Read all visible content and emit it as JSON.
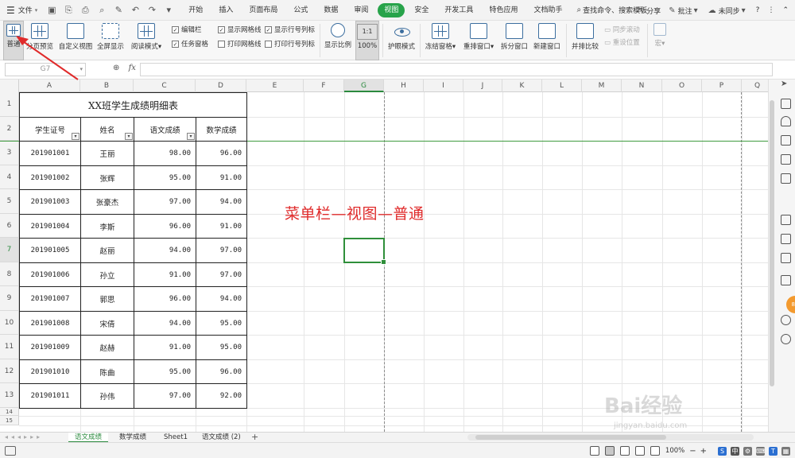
{
  "menubar": {
    "file_label": "文件",
    "tabs": [
      "开始",
      "插入",
      "页面布局",
      "公式",
      "数据",
      "审阅",
      "视图",
      "安全",
      "开发工具",
      "特色应用",
      "文档助手"
    ],
    "active_tab": "视图",
    "search_label": "查找命令、搜索模板",
    "share_label": "分享",
    "comment_label": "批注",
    "sync_label": "未同步",
    "help_label": "?"
  },
  "ribbon": {
    "normal": "普通",
    "page_preview": "分页预览",
    "custom_view": "自定义视图",
    "fullscreen": "全屏显示",
    "reading_mode": "阅读模式",
    "checks_col1": [
      "编辑栏",
      "任务窗格"
    ],
    "checks_col2": [
      "显示网格线",
      "打印网格线"
    ],
    "checks_col3": [
      "显示行号列标",
      "打印行号列标"
    ],
    "zoom_ratio": "显示比例",
    "zoom_100": "100%",
    "eye_mode": "护眼模式",
    "freeze": "冻结窗格",
    "rearrange": "重排窗口",
    "split": "拆分窗口",
    "new_window": "新建窗口",
    "side_by_side": "并排比较",
    "sync_scroll": "同步滚动",
    "reset_position": "重设位置",
    "macro": "宏"
  },
  "formula_bar": {
    "name_box": "G7",
    "fx": "fx"
  },
  "columns": [
    "A",
    "B",
    "C",
    "D",
    "E",
    "F",
    "G",
    "H",
    "I",
    "J",
    "K",
    "L",
    "M",
    "N",
    "O",
    "P",
    "Q"
  ],
  "selected_column": "G",
  "rows": [
    "1",
    "2",
    "3",
    "4",
    "5",
    "6",
    "7",
    "8",
    "9",
    "10",
    "11",
    "12",
    "13",
    "14",
    "15"
  ],
  "selected_row": "7",
  "sheet": {
    "title": "XX班学生成绩明细表",
    "headers": [
      "学生证号",
      "姓名",
      "语文成绩",
      "数学成绩"
    ],
    "records": [
      [
        "201901001",
        "王丽",
        "98.00",
        "96.00"
      ],
      [
        "201901002",
        "张辉",
        "95.00",
        "91.00"
      ],
      [
        "201901003",
        "张豪杰",
        "97.00",
        "94.00"
      ],
      [
        "201901004",
        "李斯",
        "96.00",
        "91.00"
      ],
      [
        "201901005",
        "赵丽",
        "94.00",
        "97.00"
      ],
      [
        "201901006",
        "孙立",
        "91.00",
        "97.00"
      ],
      [
        "201901007",
        "郭思",
        "96.00",
        "94.00"
      ],
      [
        "201901008",
        "宋倩",
        "94.00",
        "95.00"
      ],
      [
        "201901009",
        "赵赫",
        "91.00",
        "95.00"
      ],
      [
        "201901010",
        "陈曲",
        "95.00",
        "96.00"
      ],
      [
        "201901011",
        "孙伟",
        "97.00",
        "92.00"
      ]
    ]
  },
  "annotation": "菜单栏—视图—普通",
  "sheet_tabs": [
    "语文成绩",
    "数学成绩",
    "Sheet1",
    "语文成绩 (2)"
  ],
  "active_sheet_tab": "语文成绩",
  "status": {
    "zoom": "100%",
    "zoom_minus": "−",
    "zoom_plus": "+"
  },
  "watermark": {
    "main": "Bai经验",
    "sub": "jingyan.baidu.com"
  },
  "colors": {
    "accent_green": "#27a34a",
    "annotation_red": "#e02b2b",
    "selection_green": "#2f8f3a"
  }
}
